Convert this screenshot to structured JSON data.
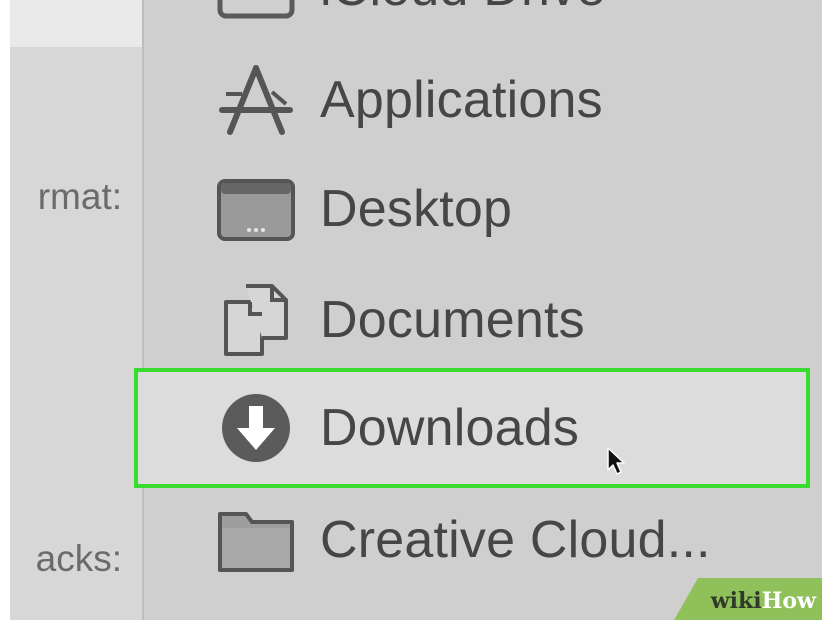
{
  "left_pane": {
    "format_label": "rmat:",
    "acks_label": "acks:"
  },
  "menu": {
    "items": [
      {
        "label": "iCloud Drive",
        "icon": "cloud-folder-icon"
      },
      {
        "label": "Applications",
        "icon": "applications-icon"
      },
      {
        "label": "Desktop",
        "icon": "desktop-icon"
      },
      {
        "label": "Documents",
        "icon": "documents-icon"
      },
      {
        "label": "Downloads",
        "icon": "downloads-icon",
        "selected": true
      },
      {
        "label": "Creative Cloud...",
        "icon": "folder-icon"
      }
    ]
  },
  "watermark": {
    "wiki": "wiki",
    "how": "How"
  },
  "colors": {
    "menu_bg": "#cfcfcf",
    "highlight_border": "#39dd31",
    "text": "#464646",
    "watermark_green": "#8fc05a"
  }
}
